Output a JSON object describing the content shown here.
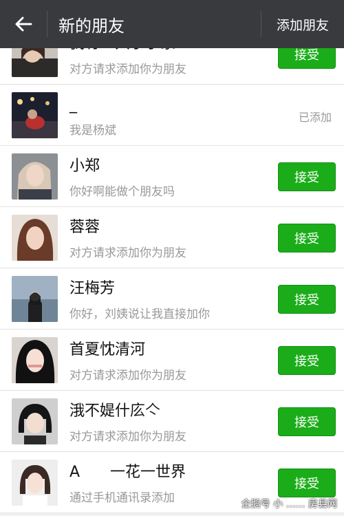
{
  "header": {
    "title": "新的朋友",
    "add_friend_label": "添加朋友"
  },
  "friends": [
    {
      "name": "我有一只小手家",
      "message": "对方请求添加你为朋友",
      "action": "接受"
    },
    {
      "name": "_",
      "message": "我是杨斌",
      "status": "已添加"
    },
    {
      "name": "小郑",
      "message": "你好啊能做个朋友吗",
      "action": "接受"
    },
    {
      "name": "蓉蓉",
      "message": "对方请求添加你为朋友",
      "action": "接受"
    },
    {
      "name": "汪梅芳",
      "message": "你好，刘姨说让我直接加你",
      "action": "接受"
    },
    {
      "name": "首夏忱清河",
      "message": "对方请求添加你为朋友",
      "action": "接受"
    },
    {
      "name": "涐不媞什庅亽",
      "message": "对方请求添加你为朋友",
      "action": "接受"
    },
    {
      "name": "A　　一花一世界",
      "message": "通过手机通讯录添加",
      "action": "接受"
    }
  ],
  "watermark": "企鹅号 小 …… 房县网",
  "colors": {
    "header_bg": "#393a3e",
    "accept_green": "#1aad19"
  },
  "icons": {
    "back": "arrow-left-icon"
  }
}
